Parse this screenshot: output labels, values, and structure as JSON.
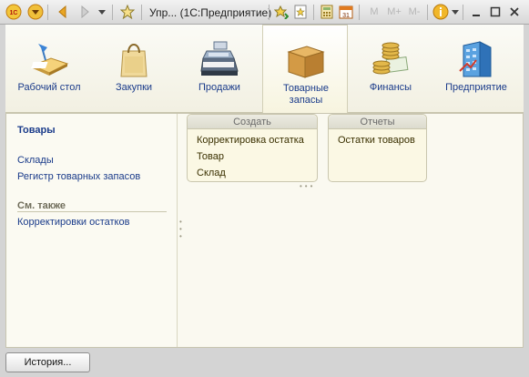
{
  "titlebar": {
    "title": "Упр... (1С:Предприятие)",
    "logo_text": "1С",
    "memory_buttons": [
      "M",
      "M+",
      "M-"
    ],
    "calendar_day": "31",
    "icons": [
      "1c-logo-icon",
      "dropdown-menu-icon",
      "back-arrow-icon",
      "forward-arrow-icon",
      "history-dropdown-icon",
      "favorites-star-icon",
      "add-favorite-icon",
      "favorites-list-icon",
      "calculator-icon",
      "calendar-icon",
      "info-icon",
      "minimize-icon",
      "maximize-icon",
      "close-icon"
    ]
  },
  "sections": [
    {
      "label": "Рабочий стол",
      "icon": "desktop-icon"
    },
    {
      "label": "Закупки",
      "icon": "shopping-bag-icon"
    },
    {
      "label": "Продажи",
      "icon": "cash-register-icon"
    },
    {
      "label": "Товарные запасы",
      "icon": "box-icon",
      "active": true
    },
    {
      "label": "Финансы",
      "icon": "coins-icon"
    },
    {
      "label": "Предприятие",
      "icon": "building-icon"
    }
  ],
  "nav": {
    "title": "Товары",
    "links": [
      "Склады",
      "Регистр товарных запасов"
    ],
    "see_also_title": "См. также",
    "see_also_links": [
      "Корректировки остатков"
    ]
  },
  "create_panel": {
    "title": "Создать",
    "items": [
      "Корректировка остатка",
      "Товар",
      "Склад"
    ]
  },
  "reports_panel": {
    "title": "Отчеты",
    "items": [
      "Остатки товаров"
    ]
  },
  "bottom": {
    "history_button": "История..."
  },
  "colors": {
    "link": "#1a3b8a",
    "panel_bg": "#fbf8e4",
    "active_section_bg": "#ffffff"
  }
}
